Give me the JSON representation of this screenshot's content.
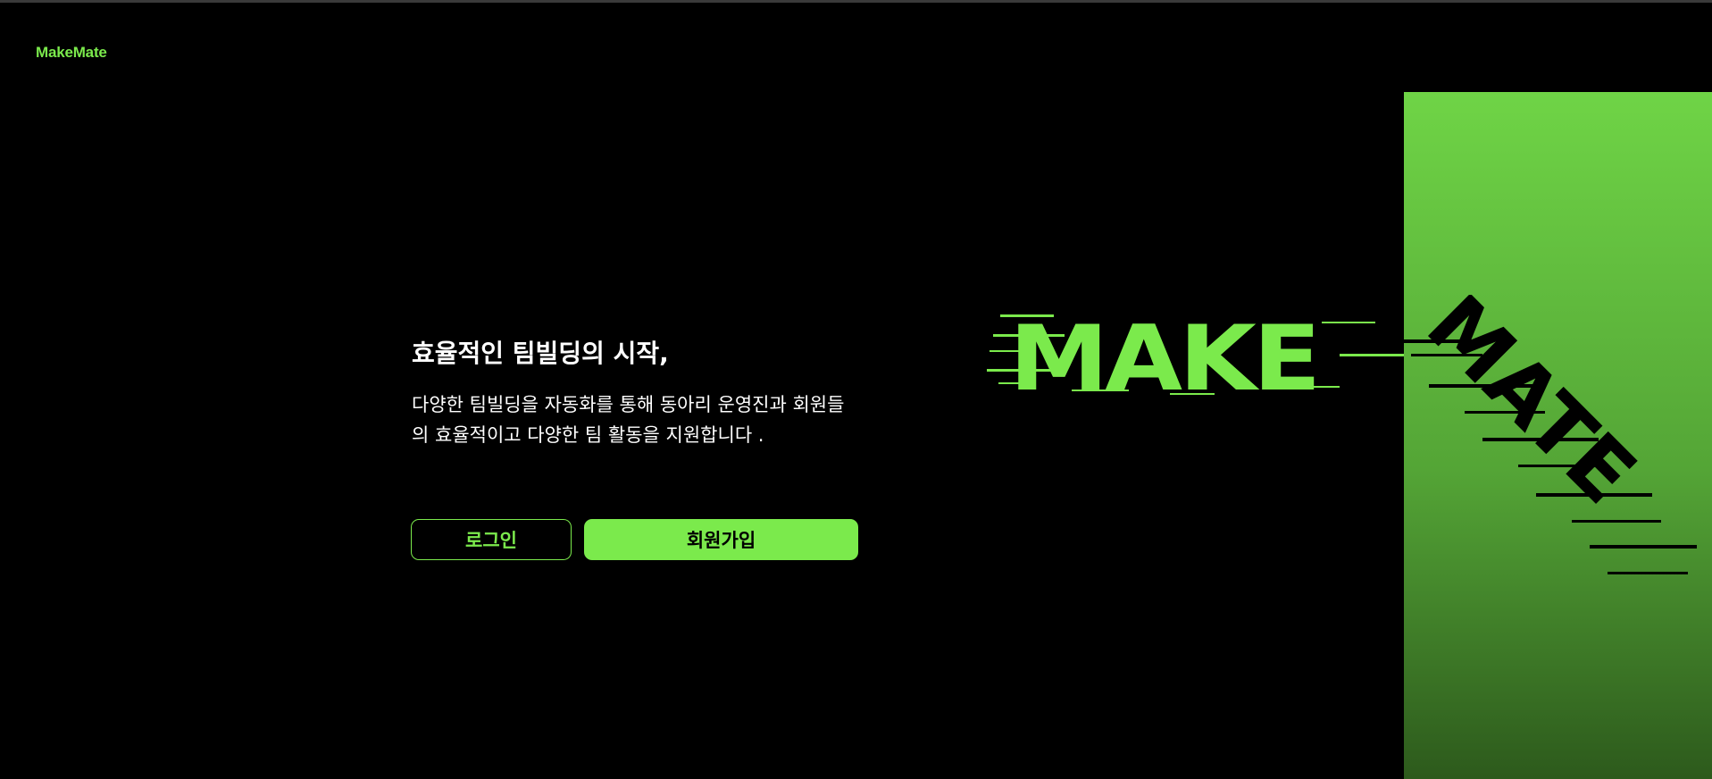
{
  "header": {
    "logo_text": "MakeMate"
  },
  "hero": {
    "title": "효율적인 팀빌딩의 시작,",
    "description": "다양한 팀빌딩을 자동화를 통해 동아리 운영진과 회원들의 효율적이고 다양한 팀 활동을 지원합니다 ."
  },
  "buttons": {
    "login_label": "로그인",
    "signup_label": "회원가입"
  },
  "art": {
    "word_1": "MAKE",
    "word_2": "MATE"
  },
  "colors": {
    "accent": "#7bea4c",
    "background": "#000000",
    "panel_top": "#6fd446",
    "panel_bottom": "#2d5a1c"
  }
}
